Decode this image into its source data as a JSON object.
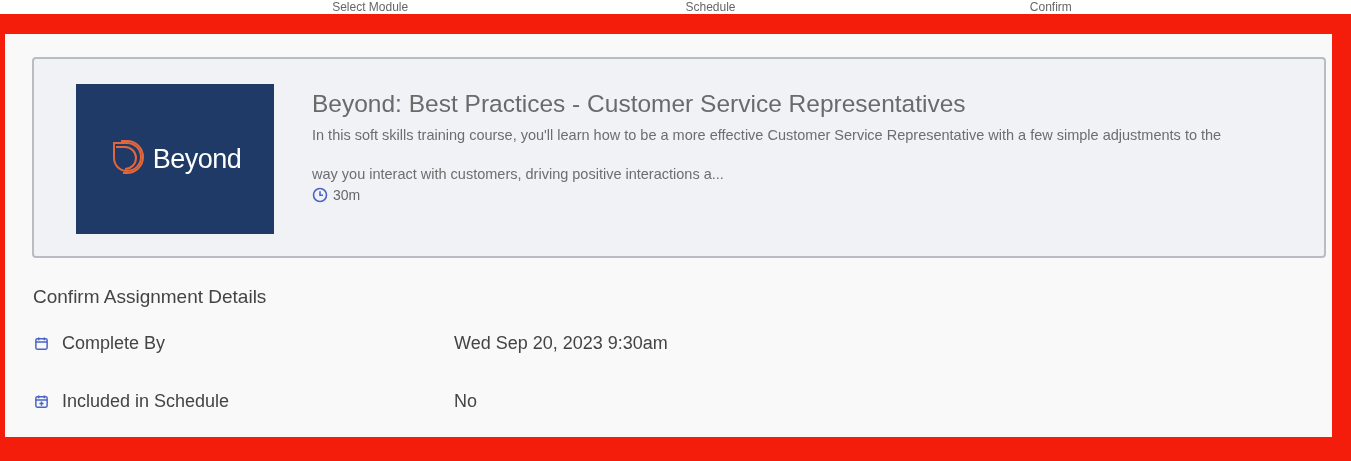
{
  "steps": [
    {
      "label": "Select Module"
    },
    {
      "label": "Schedule"
    },
    {
      "label": "Confirm"
    }
  ],
  "module": {
    "logo_text": "Beyond",
    "title": "Beyond: Best Practices - Customer Service Representatives",
    "description": "In this soft skills training course, you'll learn how to be a more effective Customer Service Representative with a few simple adjustments to the way you interact with customers, driving positive interactions a...",
    "duration": "30m"
  },
  "details": {
    "heading": "Confirm Assignment Details",
    "rows": [
      {
        "kind": "due",
        "label": "Complete By",
        "value": "Wed Sep 20, 2023 9:30am"
      },
      {
        "kind": "schedule",
        "label": "Included in Schedule",
        "value": "No"
      }
    ]
  }
}
